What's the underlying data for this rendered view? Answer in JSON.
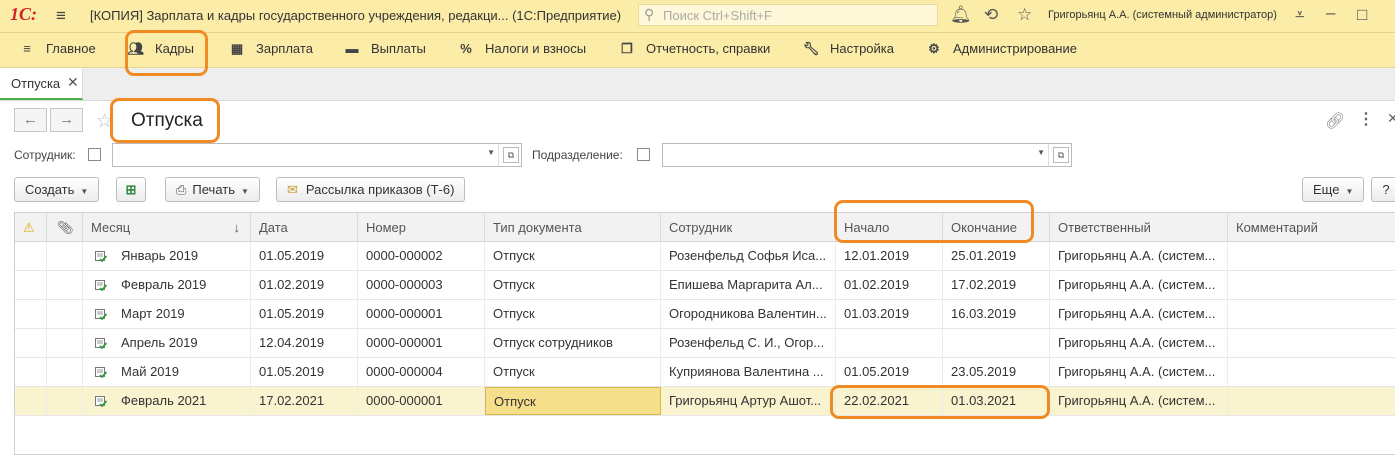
{
  "titlebar": {
    "logo": "1С:",
    "window_title": "[КОПИЯ] Зарплата и кадры государственного учреждения, редакци...  (1С:Предприятие)",
    "search_placeholder": "Поиск Ctrl+Shift+F",
    "user": "Григорьянц А.А. (системный администратор)"
  },
  "sections": [
    "Главное",
    "Кадры",
    "Зарплата",
    "Выплаты",
    "Налоги и взносы",
    "Отчетность, справки",
    "Настройка",
    "Администрирование"
  ],
  "tab": {
    "label": "Отпуска"
  },
  "form": {
    "title": "Отпуска",
    "filter_employee_label": "Сотрудник:",
    "filter_department_label": "Подразделение:"
  },
  "toolbar": {
    "create": "Создать",
    "print": "Печать",
    "mailing": "Рассылка приказов (Т-6)",
    "more": "Еще",
    "help": "?"
  },
  "table": {
    "columns": [
      "Месяц",
      "Дата",
      "Номер",
      "Тип документа",
      "Сотрудник",
      "Начало",
      "Окончание",
      "Ответственный",
      "Комментарий"
    ],
    "sort_indicator": "↓",
    "rows": [
      {
        "month": "Январь 2019",
        "date": "01.05.2019",
        "number": "0000-000002",
        "type": "Отпуск",
        "employee": "Розенфельд Софья Иса...",
        "start": "12.01.2019",
        "end": "25.01.2019",
        "responsible": "Григорьянц А.А. (систем...",
        "comment": ""
      },
      {
        "month": "Февраль 2019",
        "date": "01.02.2019",
        "number": "0000-000003",
        "type": "Отпуск",
        "employee": "Епишева Маргарита Ал...",
        "start": "01.02.2019",
        "end": "17.02.2019",
        "responsible": "Григорьянц А.А. (систем...",
        "comment": ""
      },
      {
        "month": "Март 2019",
        "date": "01.05.2019",
        "number": "0000-000001",
        "type": "Отпуск",
        "employee": "Огородникова Валентин...",
        "start": "01.03.2019",
        "end": "16.03.2019",
        "responsible": "Григорьянц А.А. (систем...",
        "comment": ""
      },
      {
        "month": "Апрель 2019",
        "date": "12.04.2019",
        "number": "0000-000001",
        "type": "Отпуск сотрудников",
        "employee": "Розенфельд С. И., Огор...",
        "start": "",
        "end": "",
        "responsible": "Григорьянц А.А. (систем...",
        "comment": ""
      },
      {
        "month": "Май 2019",
        "date": "01.05.2019",
        "number": "0000-000004",
        "type": "Отпуск",
        "employee": "Куприянова Валентина ...",
        "start": "01.05.2019",
        "end": "23.05.2019",
        "responsible": "Григорьянц А.А. (систем...",
        "comment": ""
      },
      {
        "month": "Февраль 2021",
        "date": "17.02.2021",
        "number": "0000-000001",
        "type": "Отпуск",
        "employee": "Григорьянц Артур Ашот...",
        "start": "22.02.2021",
        "end": "01.03.2021",
        "responsible": "Григорьянц А.А. (систем...",
        "comment": ""
      }
    ]
  },
  "colors": {
    "accent_bar": "#fbeca8",
    "highlight": "#f08a24",
    "selected_row": "#faf3cf"
  }
}
